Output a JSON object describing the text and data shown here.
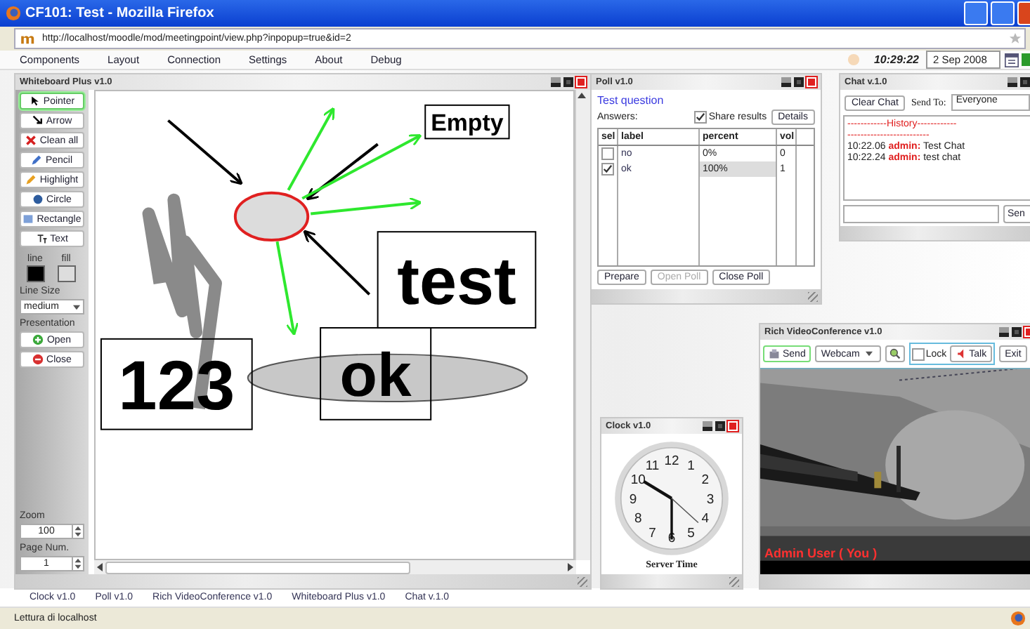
{
  "browser": {
    "title": "CF101: Test - Mozilla Firefox",
    "url": "http://localhost/moodle/mod/meetingpoint/view.php?inpopup=true&id=2",
    "status": "Lettura di localhost"
  },
  "menu": [
    "Components",
    "Layout",
    "Connection",
    "Settings",
    "About",
    "Debug"
  ],
  "time": "10:29:22",
  "date": "2 Sep 2008",
  "whiteboard": {
    "title": "Whiteboard Plus v1.0",
    "tools": [
      {
        "kind": "pointer",
        "label": "Pointer",
        "selected": true
      },
      {
        "kind": "arrow",
        "label": "Arrow",
        "selected": false
      },
      {
        "kind": "clean",
        "label": "Clean all",
        "selected": false
      },
      {
        "kind": "pencil",
        "label": "Pencil",
        "selected": false
      },
      {
        "kind": "highlight",
        "label": "Highlight",
        "selected": false
      },
      {
        "kind": "circle",
        "label": "Circle",
        "selected": false
      },
      {
        "kind": "rectangle",
        "label": "Rectangle",
        "selected": false
      },
      {
        "kind": "text",
        "label": "Text",
        "selected": false
      }
    ],
    "line_label": "line",
    "fill_label": "fill",
    "line_size_label": "Line Size",
    "line_size": "medium",
    "presentation_label": "Presentation",
    "presentation_buttons": [
      {
        "kind": "open",
        "label": "Open"
      },
      {
        "kind": "close",
        "label": "Close"
      }
    ],
    "zoom_label": "Zoom",
    "zoom": "100",
    "page_label": "Page Num.",
    "page": "1",
    "canvas_texts": [
      "Empty",
      "test",
      "123",
      "ok"
    ]
  },
  "poll": {
    "title": "Poll v1.0",
    "question": "Test question",
    "answers_label": "Answers:",
    "share_results": {
      "label": "Share results",
      "checked": true
    },
    "details": "Details",
    "columns": [
      "sel",
      "label",
      "percent",
      "vol"
    ],
    "rows": [
      {
        "checked": false,
        "label": "no",
        "percent": "0%",
        "vol": "0",
        "selected": false
      },
      {
        "checked": true,
        "label": "ok",
        "percent": "100%",
        "vol": "1",
        "selected": true
      }
    ],
    "buttons": [
      {
        "label": "Prepare",
        "disabled": false
      },
      {
        "label": "Open Poll",
        "disabled": true
      },
      {
        "label": "Close Poll",
        "disabled": false
      }
    ]
  },
  "chat": {
    "title": "Chat v.1.0",
    "clear": "Clear Chat",
    "send_to_label": "Send To:",
    "send_to": "Everyone",
    "history": [
      {
        "kind": "divider",
        "text": "------------History------------"
      },
      {
        "kind": "divider",
        "text": "-------------------------"
      },
      {
        "kind": "message",
        "time": "10:22.06",
        "user": "admin:",
        "text": "Test Chat"
      },
      {
        "kind": "message",
        "time": "10:22.24",
        "user": "admin:",
        "text": "test chat"
      }
    ],
    "send": "Sen"
  },
  "clock": {
    "title": "Clock v1.0",
    "numerals": [
      "11",
      "12",
      "1",
      "10",
      "2",
      "9",
      "3",
      "8",
      "4",
      "7",
      "6",
      "5"
    ],
    "caption": "Server Time"
  },
  "video": {
    "title": "Rich VideoConference v1.0",
    "send": "Send",
    "source": "Webcam",
    "lock": {
      "label": "Lock",
      "checked": false
    },
    "talk": "Talk",
    "exit": "Exit",
    "user": "Admin User ( You )"
  },
  "taskbar": [
    "Clock v1.0",
    "Poll v1.0",
    "Rich VideoConference v1.0",
    "Whiteboard Plus v1.0",
    "Chat v.1.0"
  ]
}
